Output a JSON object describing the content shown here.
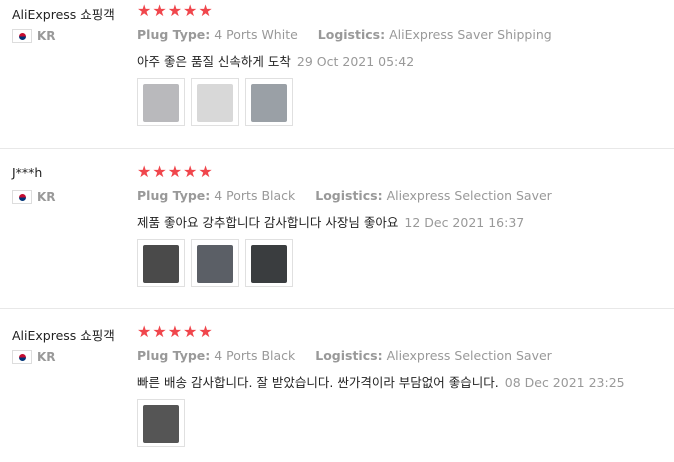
{
  "reviews": [
    {
      "name": "AliExpress 쇼핑객",
      "country": "KR",
      "stars": "★★★★★",
      "plug_label": "Plug Type:",
      "plug_value": "4 Ports White",
      "logistics_label": "Logistics:",
      "logistics_value": "AliExpress Saver Shipping",
      "text": "아주 좋은 품질 신속하게 도착",
      "date": "29 Oct 2021 05:42",
      "photo_colors": [
        "#b9b9bc",
        "#d8d8d8",
        "#9aa0a6"
      ]
    },
    {
      "name": "J***h",
      "country": "KR",
      "stars": "★★★★★",
      "plug_label": "Plug Type:",
      "plug_value": "4 Ports Black",
      "logistics_label": "Logistics:",
      "logistics_value": "Aliexpress Selection Saver",
      "text": "제품 좋아요 강추합니다 감사합니다 사장님 좋아요",
      "date": "12 Dec 2021 16:37",
      "photo_colors": [
        "#4a4a4a",
        "#5b5f66",
        "#3a3d3f"
      ]
    },
    {
      "name": "AliExpress 쇼핑객",
      "country": "KR",
      "stars": "★★★★★",
      "plug_label": "Plug Type:",
      "plug_value": "4 Ports Black",
      "logistics_label": "Logistics:",
      "logistics_value": "Aliexpress Selection Saver",
      "text": "빠른 배송 감사합니다. 잘 받았습니다. 싼가격이라 부담없어 좋습니다.",
      "date": "08 Dec 2021 23:25",
      "photo_colors": [
        "#555555"
      ]
    }
  ]
}
